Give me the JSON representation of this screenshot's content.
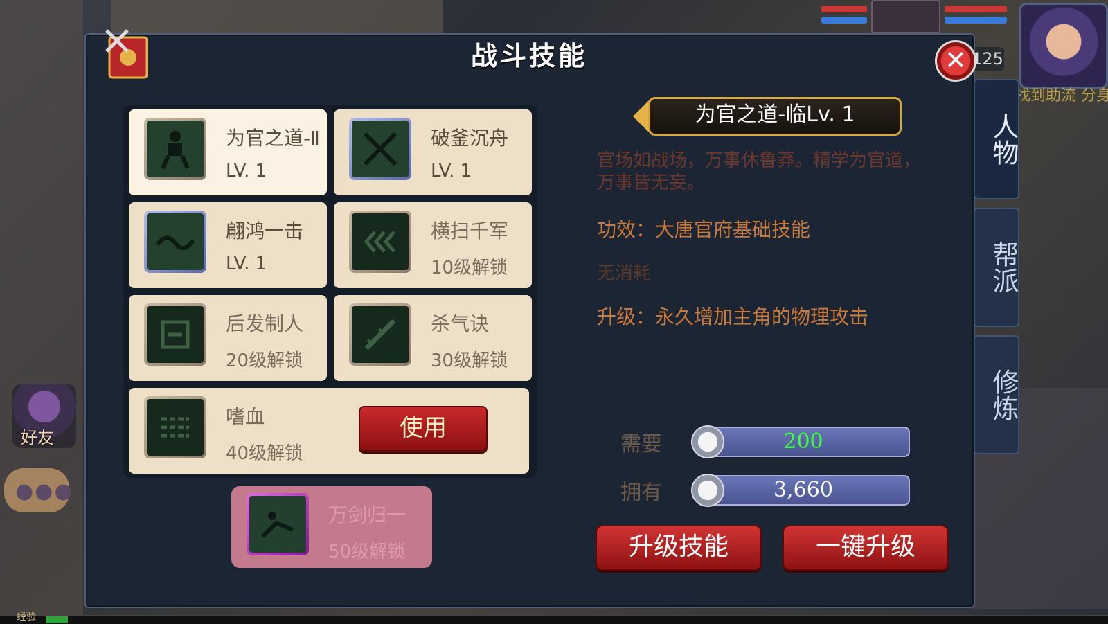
{
  "panel": {
    "title": "战斗技能",
    "close_label": "✕"
  },
  "skills": [
    {
      "name": "为官之道-Ⅱ",
      "sub": "LV. 1",
      "selected": true
    },
    {
      "name": "破釜沉舟",
      "sub": "LV. 1"
    },
    {
      "name": "翩鸿一击",
      "sub": "LV. 1"
    },
    {
      "name": "横扫千军",
      "sub": "10级解锁"
    },
    {
      "name": "后发制人",
      "sub": "20级解锁"
    },
    {
      "name": "杀气诀",
      "sub": "30级解锁"
    },
    {
      "name": "嗜血",
      "sub": "40级解锁",
      "button": "使用"
    },
    {
      "name": "万剑归一",
      "sub": "50级解锁"
    }
  ],
  "detail": {
    "banner": "为官之道-临Lv. 1",
    "description": "官场如战场，万事休鲁莽。精学为官道，万事皆无妄。",
    "effect": "功效：大唐官府基础技能",
    "cost": "无消耗",
    "upgrade": "升级：永久增加主角的物理攻击",
    "need_label": "需要",
    "need_value": "200",
    "have_label": "拥有",
    "have_value": "3,660",
    "upgrade_btn": "升级技能",
    "oneclick_btn": "一键升级"
  },
  "side_tabs": [
    "人物",
    "帮派",
    "修炼"
  ],
  "hud": {
    "level": "125",
    "quest": "找到助流 分身",
    "friend_label": "好友",
    "exp_label": "经验"
  }
}
